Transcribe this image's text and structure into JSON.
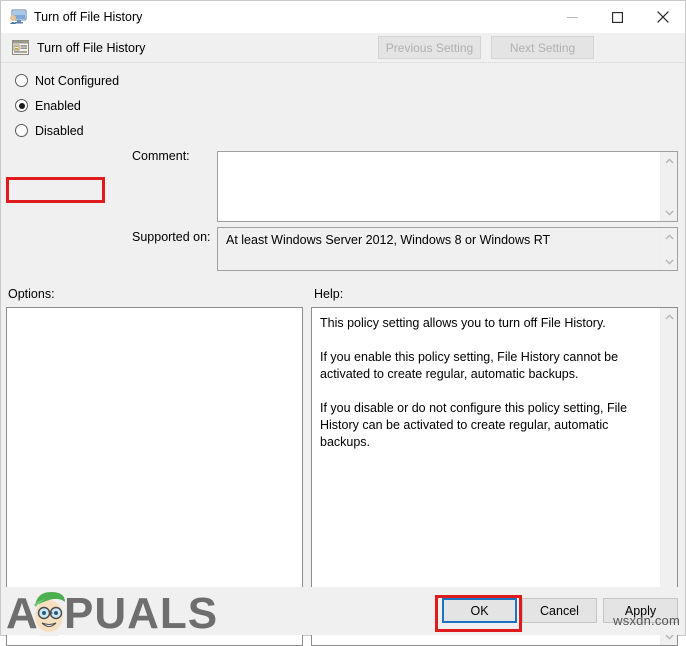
{
  "window": {
    "title": "Turn off File History",
    "icon": "monitor-icon",
    "minimize_glyph": "–",
    "maximize_glyph": "☐",
    "close_glyph": "✕"
  },
  "header": {
    "policy_title": "Turn off File History",
    "icon": "policy-setting-icon",
    "previous_setting_label": "Previous Setting",
    "next_setting_label": "Next Setting"
  },
  "state_options": {
    "items": [
      {
        "label": "Not Configured",
        "selected": false
      },
      {
        "label": "Enabled",
        "selected": true
      },
      {
        "label": "Disabled",
        "selected": false
      }
    ],
    "selected_value": "Enabled"
  },
  "comment": {
    "label": "Comment:",
    "value": "",
    "placeholder": ""
  },
  "supported_on": {
    "label": "Supported on:",
    "value": "At least Windows Server 2012, Windows 8 or Windows RT"
  },
  "options": {
    "label": "Options:",
    "content": ""
  },
  "help": {
    "label": "Help:",
    "paragraphs": [
      "This policy setting allows you to turn off File History.",
      "If you enable this policy setting, File History cannot be activated to create regular, automatic backups.",
      "If you disable or do not configure this policy setting, File History can be activated to create regular, automatic backups."
    ]
  },
  "footer": {
    "ok_label": "OK",
    "cancel_label": "Cancel",
    "apply_label": "Apply"
  },
  "annotations": {
    "highlight_color": "#e01b1b",
    "focus_color": "#1b74c2",
    "enabled_highlight_target": "Enabled",
    "ok_highlight_target": "OK"
  },
  "watermarks": {
    "brand_text": "APPUALS",
    "site_text": "wsxdn.com"
  }
}
